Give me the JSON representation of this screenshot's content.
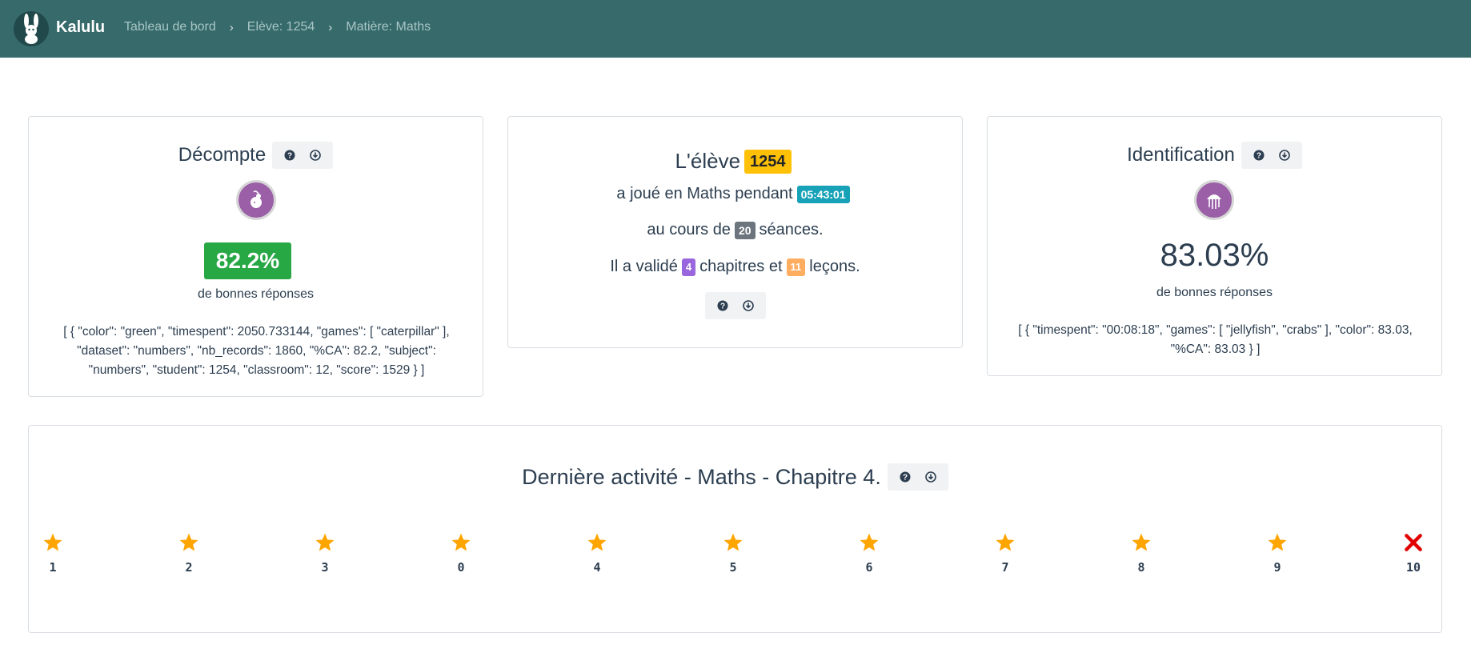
{
  "navbar": {
    "brand": "Kalulu",
    "breadcrumbs": [
      "Tableau de bord",
      "Elève: 1254",
      "Matière: Maths"
    ],
    "separator": "›",
    "color": "#366a6b"
  },
  "decompte": {
    "title": "Décompte",
    "score": "82.2%",
    "score_label": "de bonnes réponses",
    "raw": "[ { \"color\": \"green\", \"timespent\": 2050.733144, \"games\": [ \"caterpillar\" ], \"dataset\": \"numbers\", \"nb_records\": 1860, \"%CA\": 82.2, \"subject\": \"numbers\", \"student\": 1254, \"classroom\": 12, \"score\": 1529 } ]",
    "avatar_icon": "caterpillar-icon"
  },
  "eleve": {
    "title_prefix": "L'élève",
    "student_id": "1254",
    "line1_text": "a joué en Maths pendant",
    "time": "05:43:01",
    "line2_prefix": "au cours de",
    "sessions": "20",
    "line2_suffix": "séances.",
    "line3_prefix": "Il a validé",
    "chapters": "4",
    "line3_mid": "chapitres et",
    "lessons": "11",
    "line3_suffix": "leçons."
  },
  "identification": {
    "title": "Identification",
    "score": "83.03%",
    "score_label": "de bonnes réponses",
    "raw": "[ { \"timespent\": \"00:08:18\", \"games\": [ \"jellyfish\", \"crabs\" ], \"color\": 83.03, \"%CA\": 83.03 } ]",
    "avatar_icon": "jellyfish-icon"
  },
  "activity": {
    "title": "Dernière activité - Maths - Chapitre 4.",
    "items": [
      {
        "label": "1",
        "status": "star"
      },
      {
        "label": "2",
        "status": "star"
      },
      {
        "label": "3",
        "status": "star"
      },
      {
        "label": "0",
        "status": "star"
      },
      {
        "label": "4",
        "status": "star"
      },
      {
        "label": "5",
        "status": "star"
      },
      {
        "label": "6",
        "status": "star"
      },
      {
        "label": "7",
        "status": "star"
      },
      {
        "label": "8",
        "status": "star"
      },
      {
        "label": "9",
        "status": "star"
      },
      {
        "label": "10",
        "status": "fail"
      }
    ],
    "star_color": "#ffa500",
    "fail_color": "#e00000"
  }
}
